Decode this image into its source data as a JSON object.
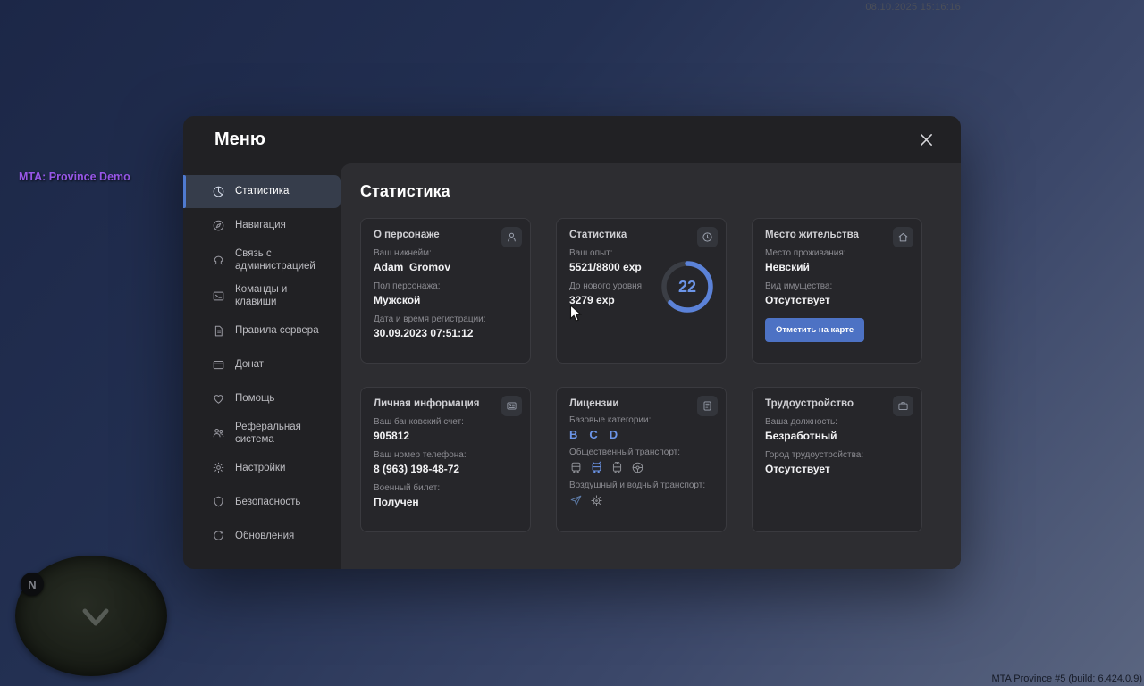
{
  "accent_color": "#5b82d8",
  "hud": {
    "timestamp": "08.10.2025 15:16:16",
    "brand": "MTA: Province Demo",
    "build_info": "MTA Province #5 (build: 6.424.0.9)",
    "minimap": {
      "compass_letter": "N"
    }
  },
  "menu": {
    "title": "Меню",
    "page_title": "Статистика",
    "sidebar": [
      {
        "label": "Статистика"
      },
      {
        "label": "Навигация"
      },
      {
        "label": "Связь с администрацией"
      },
      {
        "label": "Команды и клавиши"
      },
      {
        "label": "Правила сервера"
      },
      {
        "label": "Донат"
      },
      {
        "label": "Помощь"
      },
      {
        "label": "Реферальная система"
      },
      {
        "label": "Настройки"
      },
      {
        "label": "Безопасность"
      },
      {
        "label": "Обновления"
      }
    ],
    "cards": {
      "character": {
        "title": "О персонаже",
        "nickname_label": "Ваш никнейм:",
        "nickname": "Adam_Gromov",
        "gender_label": "Пол персонажа:",
        "gender": "Мужской",
        "registered_label": "Дата и время регистрации:",
        "registered": "30.09.2023 07:51:12"
      },
      "stats": {
        "title": "Статистика",
        "exp_label": "Ваш опыт:",
        "exp": "5521/8800 exp",
        "next_label": "До нового уровня:",
        "next": "3279 exp",
        "level": "22",
        "level_progress_percent": 63
      },
      "residence": {
        "title": "Место жительства",
        "place_label": "Место проживания:",
        "place": "Невский",
        "property_label": "Вид имущества:",
        "property": "Отсутствует",
        "map_button": "Отметить на карте"
      },
      "personal": {
        "title": "Личная информация",
        "bank_label": "Ваш банковский счет:",
        "bank": "905812",
        "phone_label": "Ваш номер телефона:",
        "phone": "8 (963) 198-48-72",
        "military_label": "Военный билет:",
        "military": "Получен"
      },
      "licenses": {
        "title": "Лицензии",
        "basic_label": "Базовые категории:",
        "categories": [
          "B",
          "C",
          "D"
        ],
        "public_label": "Общественный транспорт:",
        "air_label": "Воздушный и водный транспорт:"
      },
      "employment": {
        "title": "Трудоустройство",
        "position_label": "Ваша должность:",
        "position": "Безработный",
        "city_label": "Город трудоустройства:",
        "city": "Отсутствует"
      }
    }
  }
}
